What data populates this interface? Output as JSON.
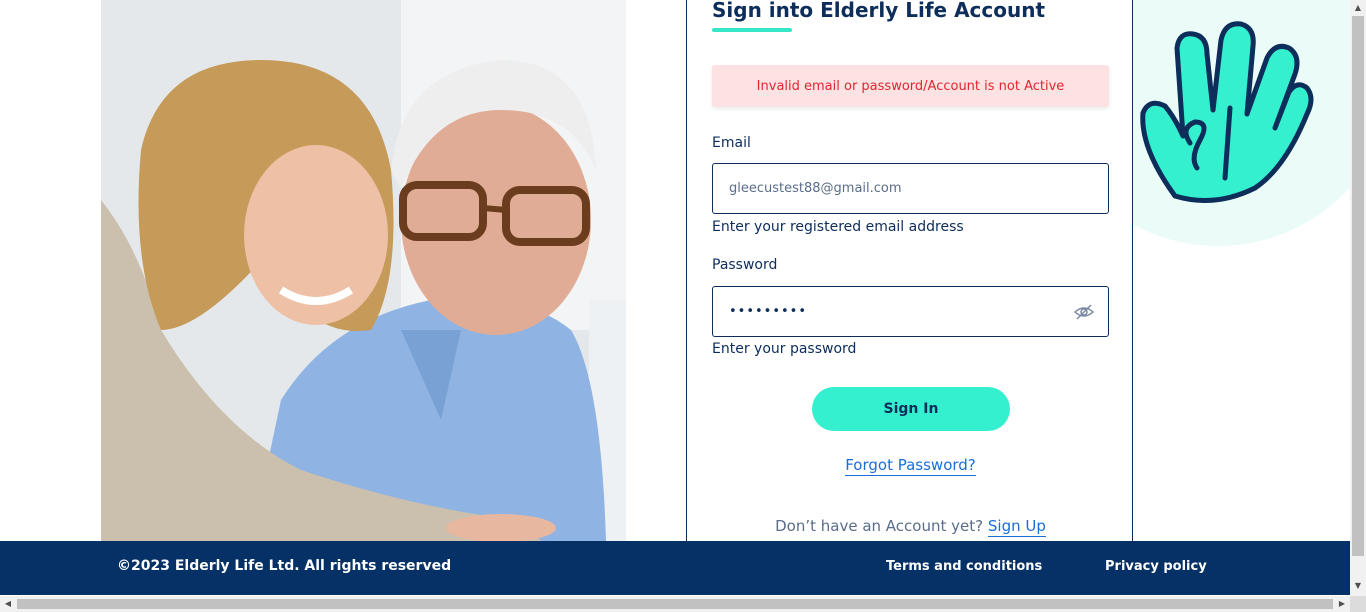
{
  "form": {
    "title": "Sign into Elderly Life Account",
    "error_message": "Invalid email or password/Account is not Active",
    "email_label": "Email",
    "email_value": "gleecustest88@gmail.com",
    "email_hint": "Enter your registered email address",
    "password_label": "Password",
    "password_masked": "•••••••••",
    "password_hint": "Enter your password",
    "sign_in_label": "Sign In",
    "forgot_password_label": "Forgot Password?",
    "no_account_text": "Don’t have an Account yet?",
    "sign_up_label": "Sign Up"
  },
  "footer": {
    "copyright": "©2023 Elderly Life Ltd. All rights reserved",
    "terms_label": "Terms and conditions",
    "privacy_label": "Privacy policy"
  },
  "icons": {
    "password_toggle": "eye-slash-icon",
    "brand_mark": "hand-logo-icon"
  },
  "colors": {
    "navy": "#0d2d5a",
    "accent_teal": "#35f0cf",
    "footer_bg": "#063166",
    "error_bg": "#fde2e3",
    "error_text": "#e0252f",
    "link": "#1a6ed8"
  }
}
